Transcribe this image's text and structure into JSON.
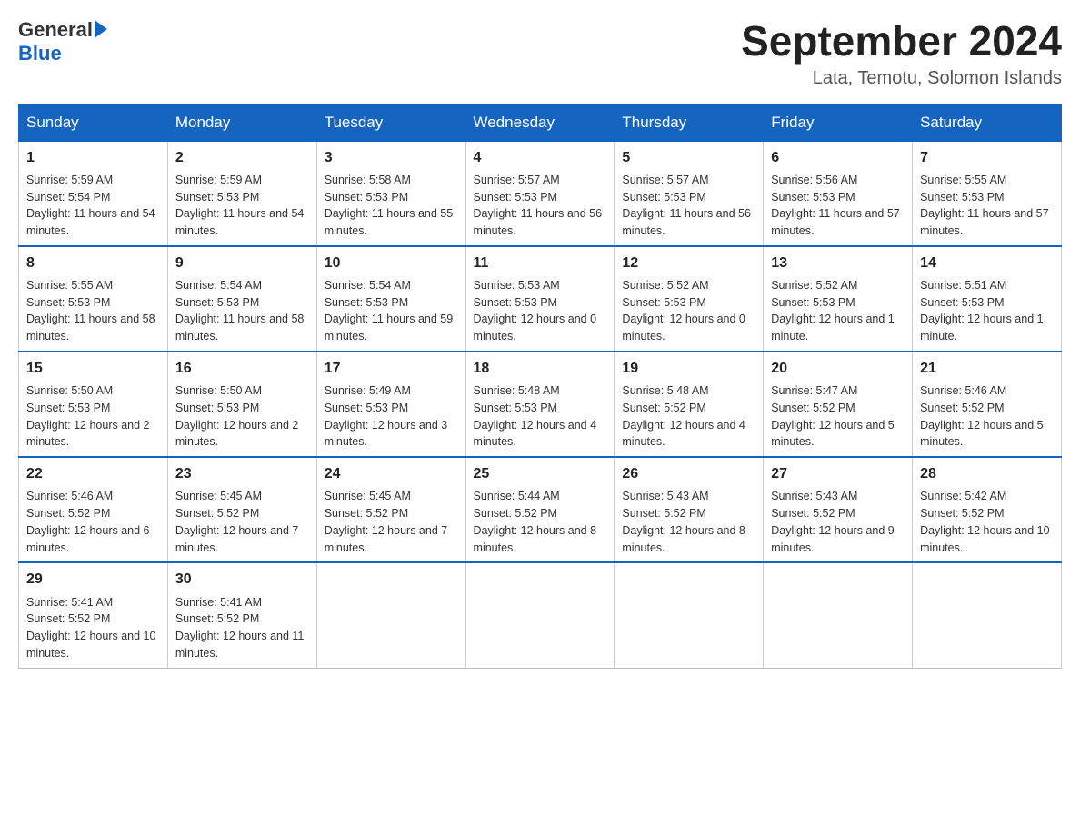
{
  "header": {
    "logo": {
      "general": "General",
      "blue": "Blue",
      "aria": "GeneralBlue logo"
    },
    "month_title": "September 2024",
    "subtitle": "Lata, Temotu, Solomon Islands"
  },
  "days_of_week": [
    "Sunday",
    "Monday",
    "Tuesday",
    "Wednesday",
    "Thursday",
    "Friday",
    "Saturday"
  ],
  "weeks": [
    [
      {
        "day": "1",
        "sunrise": "5:59 AM",
        "sunset": "5:54 PM",
        "daylight": "11 hours and 54 minutes."
      },
      {
        "day": "2",
        "sunrise": "5:59 AM",
        "sunset": "5:53 PM",
        "daylight": "11 hours and 54 minutes."
      },
      {
        "day": "3",
        "sunrise": "5:58 AM",
        "sunset": "5:53 PM",
        "daylight": "11 hours and 55 minutes."
      },
      {
        "day": "4",
        "sunrise": "5:57 AM",
        "sunset": "5:53 PM",
        "daylight": "11 hours and 56 minutes."
      },
      {
        "day": "5",
        "sunrise": "5:57 AM",
        "sunset": "5:53 PM",
        "daylight": "11 hours and 56 minutes."
      },
      {
        "day": "6",
        "sunrise": "5:56 AM",
        "sunset": "5:53 PM",
        "daylight": "11 hours and 57 minutes."
      },
      {
        "day": "7",
        "sunrise": "5:55 AM",
        "sunset": "5:53 PM",
        "daylight": "11 hours and 57 minutes."
      }
    ],
    [
      {
        "day": "8",
        "sunrise": "5:55 AM",
        "sunset": "5:53 PM",
        "daylight": "11 hours and 58 minutes."
      },
      {
        "day": "9",
        "sunrise": "5:54 AM",
        "sunset": "5:53 PM",
        "daylight": "11 hours and 58 minutes."
      },
      {
        "day": "10",
        "sunrise": "5:54 AM",
        "sunset": "5:53 PM",
        "daylight": "11 hours and 59 minutes."
      },
      {
        "day": "11",
        "sunrise": "5:53 AM",
        "sunset": "5:53 PM",
        "daylight": "12 hours and 0 minutes."
      },
      {
        "day": "12",
        "sunrise": "5:52 AM",
        "sunset": "5:53 PM",
        "daylight": "12 hours and 0 minutes."
      },
      {
        "day": "13",
        "sunrise": "5:52 AM",
        "sunset": "5:53 PM",
        "daylight": "12 hours and 1 minute."
      },
      {
        "day": "14",
        "sunrise": "5:51 AM",
        "sunset": "5:53 PM",
        "daylight": "12 hours and 1 minute."
      }
    ],
    [
      {
        "day": "15",
        "sunrise": "5:50 AM",
        "sunset": "5:53 PM",
        "daylight": "12 hours and 2 minutes."
      },
      {
        "day": "16",
        "sunrise": "5:50 AM",
        "sunset": "5:53 PM",
        "daylight": "12 hours and 2 minutes."
      },
      {
        "day": "17",
        "sunrise": "5:49 AM",
        "sunset": "5:53 PM",
        "daylight": "12 hours and 3 minutes."
      },
      {
        "day": "18",
        "sunrise": "5:48 AM",
        "sunset": "5:53 PM",
        "daylight": "12 hours and 4 minutes."
      },
      {
        "day": "19",
        "sunrise": "5:48 AM",
        "sunset": "5:52 PM",
        "daylight": "12 hours and 4 minutes."
      },
      {
        "day": "20",
        "sunrise": "5:47 AM",
        "sunset": "5:52 PM",
        "daylight": "12 hours and 5 minutes."
      },
      {
        "day": "21",
        "sunrise": "5:46 AM",
        "sunset": "5:52 PM",
        "daylight": "12 hours and 5 minutes."
      }
    ],
    [
      {
        "day": "22",
        "sunrise": "5:46 AM",
        "sunset": "5:52 PM",
        "daylight": "12 hours and 6 minutes."
      },
      {
        "day": "23",
        "sunrise": "5:45 AM",
        "sunset": "5:52 PM",
        "daylight": "12 hours and 7 minutes."
      },
      {
        "day": "24",
        "sunrise": "5:45 AM",
        "sunset": "5:52 PM",
        "daylight": "12 hours and 7 minutes."
      },
      {
        "day": "25",
        "sunrise": "5:44 AM",
        "sunset": "5:52 PM",
        "daylight": "12 hours and 8 minutes."
      },
      {
        "day": "26",
        "sunrise": "5:43 AM",
        "sunset": "5:52 PM",
        "daylight": "12 hours and 8 minutes."
      },
      {
        "day": "27",
        "sunrise": "5:43 AM",
        "sunset": "5:52 PM",
        "daylight": "12 hours and 9 minutes."
      },
      {
        "day": "28",
        "sunrise": "5:42 AM",
        "sunset": "5:52 PM",
        "daylight": "12 hours and 10 minutes."
      }
    ],
    [
      {
        "day": "29",
        "sunrise": "5:41 AM",
        "sunset": "5:52 PM",
        "daylight": "12 hours and 10 minutes."
      },
      {
        "day": "30",
        "sunrise": "5:41 AM",
        "sunset": "5:52 PM",
        "daylight": "12 hours and 11 minutes."
      },
      null,
      null,
      null,
      null,
      null
    ]
  ],
  "labels": {
    "sunrise": "Sunrise:",
    "sunset": "Sunset:",
    "daylight": "Daylight:"
  }
}
